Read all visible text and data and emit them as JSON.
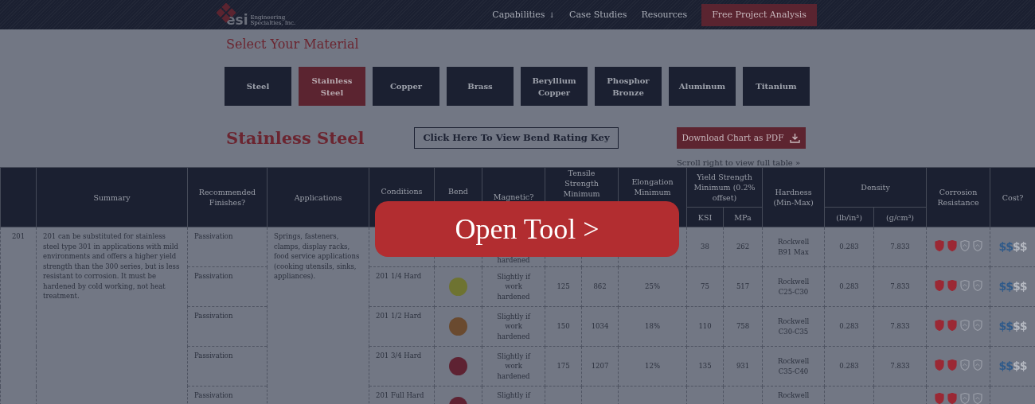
{
  "logo": {
    "text": "esi",
    "tagline": "Engineering Specialties, Inc."
  },
  "nav": {
    "links": [
      {
        "label": "Capabilities",
        "caret": "↓"
      },
      {
        "label": "Case Studies"
      },
      {
        "label": "Resources"
      }
    ],
    "cta": "Free Project Analysis"
  },
  "section_title": "Select Your Material",
  "materials": [
    {
      "label": "Steel",
      "selected": false
    },
    {
      "label": "Stainless Steel",
      "selected": true
    },
    {
      "label": "Copper",
      "selected": false
    },
    {
      "label": "Brass",
      "selected": false
    },
    {
      "label": "Beryllium Copper",
      "selected": false
    },
    {
      "label": "Phosphor Bronze",
      "selected": false
    },
    {
      "label": "Aluminum",
      "selected": false
    },
    {
      "label": "Titanium",
      "selected": false
    }
  ],
  "material_title": "Stainless Steel",
  "key_button": "Click Here To View Bend Rating Key",
  "download_button": "Download Chart as PDF",
  "scroll_hint": "Scroll right to view full table »",
  "table": {
    "headers": {
      "summary": "Summary",
      "finishes": "Recommended Finishes?",
      "applications": "Applications",
      "conditions": "Conditions",
      "bend": "Bend",
      "magnetic": "Magnetic?",
      "tensile": "Tensile Strength Minimum",
      "elongation": "Elongation Minimum",
      "yield": "Yield Strength Minimum (0.2% offset)",
      "yield_ksi": "KSI",
      "yield_mpa": "MPa",
      "hardness": "Hardness (Min-Max)",
      "density": "Density",
      "density_lb": "(lb/in³)",
      "density_g": "(g/cm³)",
      "corrosion": "Corrosion Resistance",
      "cost": "Cost?"
    },
    "grade": "201",
    "summary": "201 can be substituted for stainless steel type 301 in applications with mild environments and offers a higher yield strength than the 300 series, but is less resistant to corrosion. It must be hardened by cold working, not heat treatment.",
    "applications": "Springs, fasteners, clamps, display racks, food service applications (cooking utensils, sinks, appliances).",
    "rows": [
      {
        "finish": "Passivation",
        "magnetic": "hardened",
        "yield_ksi": "38",
        "yield_mpa": "262",
        "hardness": "Rockwell B91 Max",
        "density_lb": "0.283",
        "density_g": "7.833",
        "stars": 2,
        "cost_on": "$$",
        "cost_off": "$$"
      },
      {
        "finish": "Passivation",
        "condition": "201 1/4 Hard",
        "color": "#6e7331",
        "magnetic": "Slightly if work hardened",
        "tensile_ksi": "125",
        "tensile_mpa": "862",
        "elongation": "25%",
        "yield_ksi": "75",
        "yield_mpa": "517",
        "hardness": "Rockwell C25-C30",
        "density_lb": "0.283",
        "density_g": "7.833",
        "stars": 2,
        "cost_on": "$$",
        "cost_off": "$$"
      },
      {
        "finish": "Passivation",
        "condition": "201 1/2 Hard",
        "color": "#6a4a2f",
        "magnetic": "Slightly if work hardened",
        "tensile_ksi": "150",
        "tensile_mpa": "1034",
        "elongation": "18%",
        "yield_ksi": "110",
        "yield_mpa": "758",
        "hardness": "Rockwell C30-C35",
        "density_lb": "0.283",
        "density_g": "7.833",
        "stars": 2,
        "cost_on": "$$",
        "cost_off": "$$"
      },
      {
        "finish": "Passivation",
        "condition": "201 3/4 Hard",
        "color": "#5e2232",
        "magnetic": "Slightly if work hardened",
        "tensile_ksi": "175",
        "tensile_mpa": "1207",
        "elongation": "12%",
        "yield_ksi": "135",
        "yield_mpa": "931",
        "hardness": "Rockwell C35-C40",
        "density_lb": "0.283",
        "density_g": "7.833",
        "stars": 2,
        "cost_on": "$$",
        "cost_off": "$$"
      },
      {
        "finish": "Passivation",
        "condition": "201 Full Hard",
        "color": "#5e2232",
        "magnetic": "Slightly if",
        "hardness": "Rockwell",
        "stars": 2
      }
    ]
  },
  "overlay_button": "Open Tool >"
}
